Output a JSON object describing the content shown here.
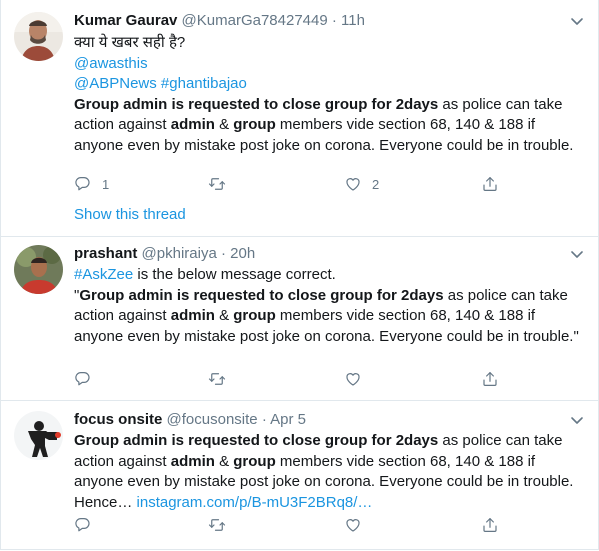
{
  "tweets": [
    {
      "name": "Kumar Gaurav",
      "handle": "@KumarGa78427449",
      "dot": "·",
      "time": "11h",
      "line1": "क्या ये खबर सही है?",
      "mention1": "@awasthis",
      "mention2": "@ABPNews",
      "hashtag": "#ghantibajao",
      "bold1": "Group admin is requested to close group for 2days",
      "t1": " as police can take action against ",
      "bold2": "admin",
      "t2": " & ",
      "bold3": "group",
      "t3": " members vide section 68, 140 & 188 if anyone even by mistake post joke on corona. Everyone could be in trouble.",
      "reply_count": "1",
      "retweet_count": "",
      "like_count": "2",
      "show_thread": "Show this thread"
    },
    {
      "name": "prashant",
      "handle": "@pkhiraiya",
      "dot": "·",
      "time": "20h",
      "hashtag": "#AskZee",
      "line1": " is the below message correct.",
      "quote_open": "\"",
      "bold1": "Group admin is requested to close group for 2days",
      "t1": " as police can take action against ",
      "bold2": "admin",
      "t2": " & ",
      "bold3": "group",
      "t3": " members vide section 68, 140 & 188 if anyone even by mistake post joke on corona. Everyone could be in trouble.\"",
      "reply_count": "",
      "retweet_count": "",
      "like_count": ""
    },
    {
      "name": "focus onsite",
      "handle": "@focusonsite",
      "dot": "·",
      "time": "Apr 5",
      "bold1": "Group admin is requested to close group for 2days",
      "t1": " as police can take action against ",
      "bold2": "admin",
      "t2": " & ",
      "bold3": "group",
      "t3": " members vide section 68, 140 & 188 if anyone even by mistake post joke on corona. Everyone could be in trouble. Hence… ",
      "link": "instagram.com/p/B-mU3F2BRq8/…",
      "reply_count": "",
      "retweet_count": "",
      "like_count": ""
    }
  ],
  "icons": {
    "caret": "chevron-down-icon",
    "reply": "reply-icon",
    "retweet": "retweet-icon",
    "like": "heart-icon",
    "share": "share-icon"
  },
  "colors": {
    "link": "#1b95e0",
    "muted": "#657786",
    "text": "#14171a",
    "border": "#e1e8ed"
  }
}
